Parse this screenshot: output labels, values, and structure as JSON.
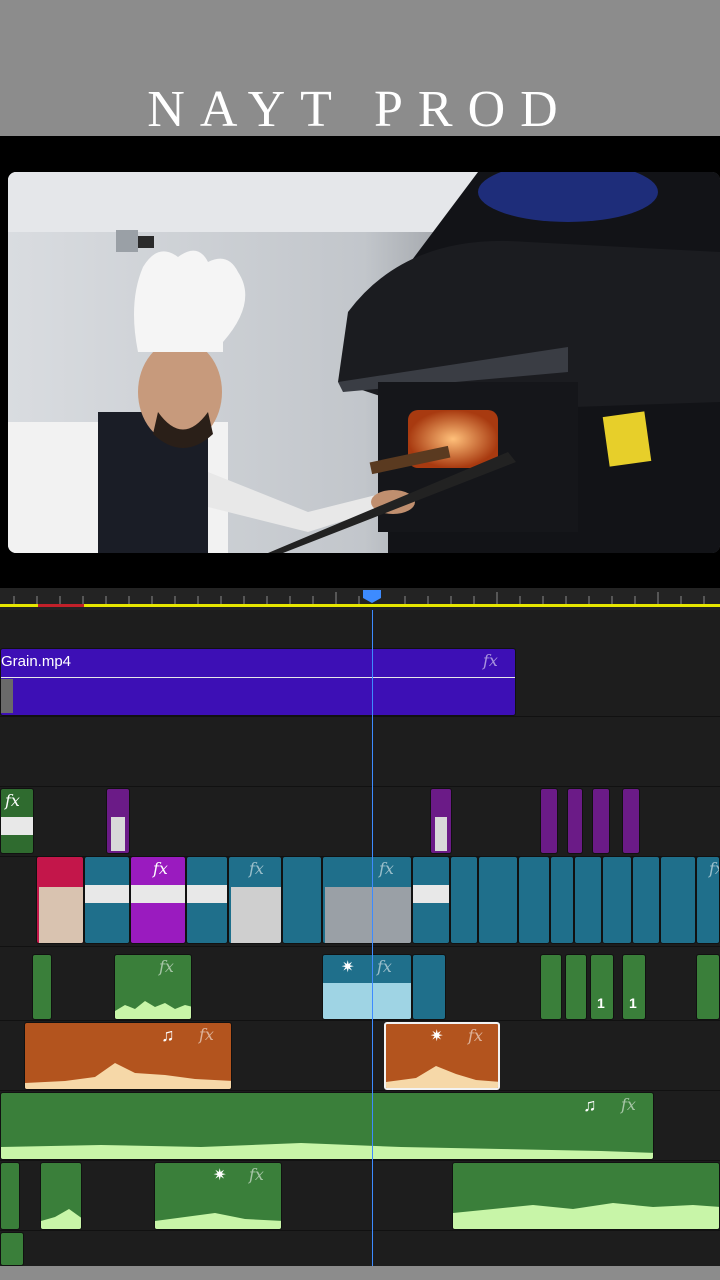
{
  "brand": {
    "title": "NAYT PROD"
  },
  "timeline": {
    "overlay_clip": {
      "name": "Grain.mp4",
      "fx": "fx"
    },
    "fx_label": "fx",
    "note_glyph": "♫",
    "star_glyph": "✷",
    "marker_number": "1"
  },
  "colors": {
    "brand_bar": "#8c8c8c",
    "playhead": "#3d8bff",
    "work_area": "#e6e600",
    "overlay_clip": "#3d0fb5",
    "video_clip": "#1f6f8b",
    "audio_clip_green": "#3a7f3a",
    "audio_clip_orange": "#b3541e"
  }
}
